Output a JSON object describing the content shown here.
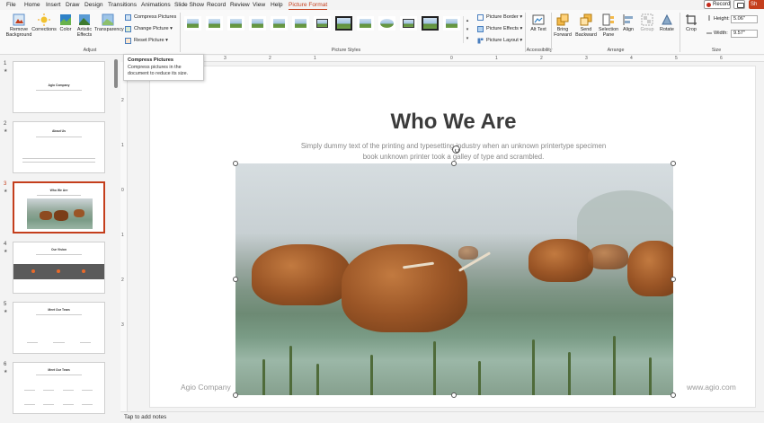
{
  "menu": {
    "items": [
      "File",
      "Home",
      "Insert",
      "Draw",
      "Design",
      "Transitions",
      "Animations",
      "Slide Show",
      "Record",
      "Review",
      "View",
      "Help",
      "Picture Format"
    ],
    "active": "Picture Format",
    "record_label": "Record",
    "share_label": "Sh"
  },
  "ribbon": {
    "adjust": {
      "remove_background": "Remove Background",
      "corrections": "Corrections",
      "color": "Color",
      "artistic_effects": "Artistic Effects",
      "transparency": "Transparency",
      "compress_pictures": "Compress Pictures",
      "change_picture": "Change Picture",
      "reset_picture": "Reset Picture",
      "group_label": "Adjust"
    },
    "picture_styles": {
      "group_label": "Picture Styles",
      "picture_border": "Picture Border",
      "picture_effects": "Picture Effects",
      "picture_layout": "Picture Layout"
    },
    "accessibility": {
      "alt_text": "Alt Text",
      "group_label": "Accessibility"
    },
    "arrange": {
      "bring_forward": "Bring Forward",
      "send_backward": "Send Backward",
      "selection_pane": "Selection Pane",
      "align": "Align",
      "group": "Group",
      "rotate": "Rotate",
      "group_label": "Arrange"
    },
    "size": {
      "crop": "Crop",
      "height_label": "Height:",
      "height_value": "5.06\"",
      "width_label": "Width:",
      "width_value": "9.57\"",
      "group_label": "Size"
    }
  },
  "tooltip": {
    "title": "Compress Pictures",
    "body": "Compress pictures in the document to reduce its size."
  },
  "slides": [
    {
      "num": "1",
      "title": "Agio Company"
    },
    {
      "num": "2",
      "title": "About Us"
    },
    {
      "num": "3",
      "title": "Who We Are"
    },
    {
      "num": "4",
      "title": "Our Vision"
    },
    {
      "num": "5",
      "title": "Meet Our Team"
    },
    {
      "num": "6",
      "title": "Meet Our Team"
    }
  ],
  "selected_slide": "3",
  "ruler": {
    "h": [
      "3",
      "2",
      "1",
      "0",
      "1",
      "2",
      "3",
      "4",
      "5",
      "6"
    ],
    "v": [
      "2",
      "1",
      "0",
      "1",
      "2",
      "3"
    ]
  },
  "slide": {
    "title": "Who We Are",
    "subtitle": "Simply dummy text of the printing and typesetting industry when an unknown printertype specimen book unknown printer took a galley of type and scrambled.",
    "footer_left": "Agio Company",
    "footer_right": "www.agio.com"
  },
  "notes_placeholder": "Tap to add notes",
  "colors": {
    "accent": "#c43e1c",
    "ribbon_bg": "#f9f9f9",
    "title": "#3b3b3b"
  }
}
